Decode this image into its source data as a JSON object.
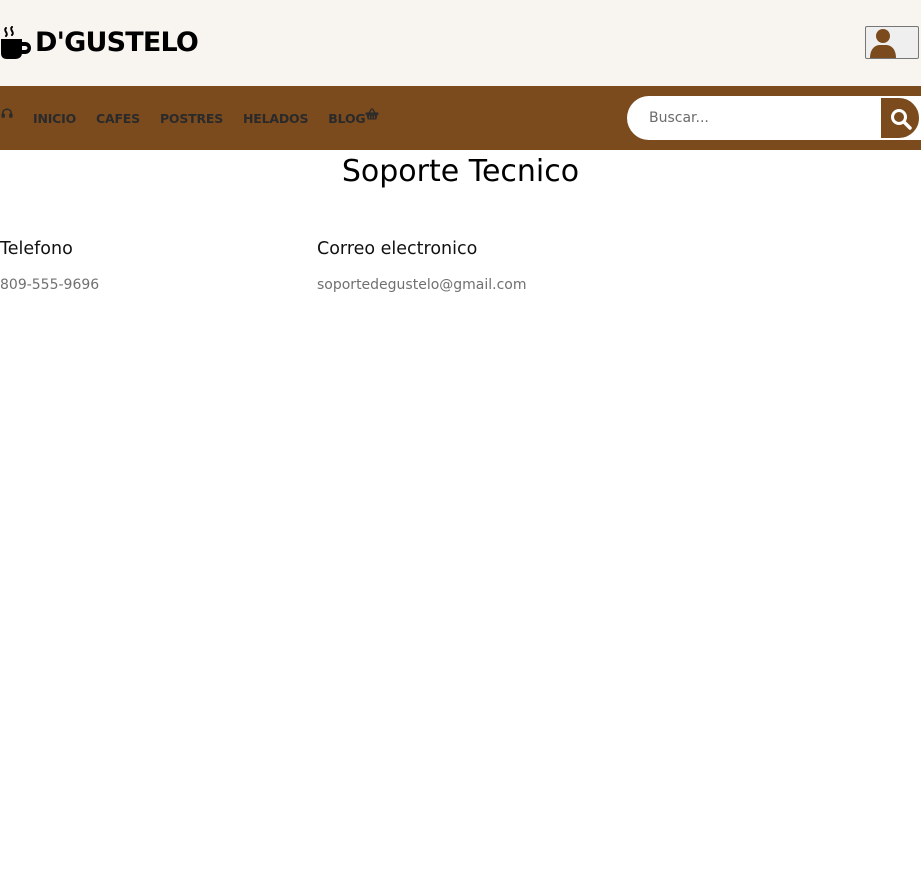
{
  "brand": {
    "name": "D'GUSTELO",
    "logo_icon": "coffee-cup-icon"
  },
  "header": {
    "user_icon": "user-icon"
  },
  "nav": {
    "headset_icon": "headset-icon",
    "links": [
      {
        "label": "INICIO"
      },
      {
        "label": "CAFES"
      },
      {
        "label": "POSTRES"
      },
      {
        "label": "HELADOS"
      },
      {
        "label": "BLOG"
      }
    ],
    "cart_icon": "shopping-basket-icon",
    "search": {
      "placeholder": "Buscar...",
      "value": "",
      "button_icon": "search-icon"
    }
  },
  "main": {
    "title": "Soporte Tecnico",
    "contacts": [
      {
        "heading": "Telefono",
        "value": "809-555-9696"
      },
      {
        "heading": "Correo electronico",
        "value": "soportedegustelo@gmail.com"
      }
    ]
  },
  "colors": {
    "brand_brown": "#7b4b1e",
    "header_background": "#f8f4f0",
    "nav_text": "#2a2a2a",
    "muted_text": "#707070"
  }
}
